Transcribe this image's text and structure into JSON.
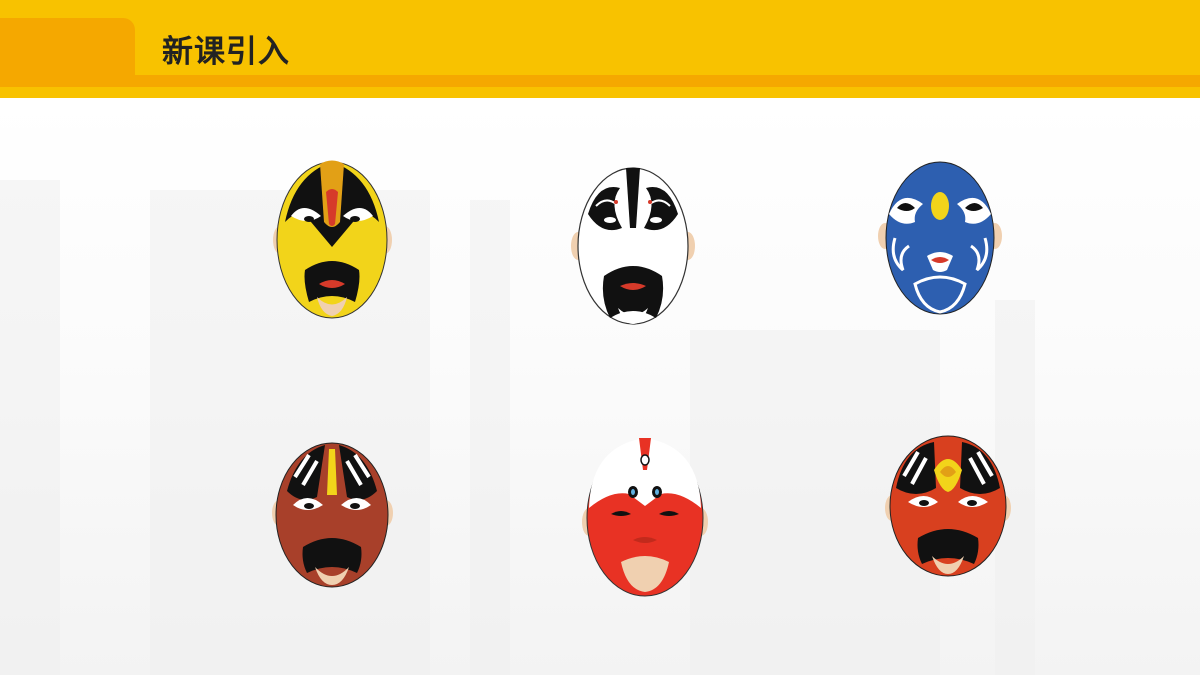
{
  "header": {
    "title": "新课引入"
  },
  "masks": [
    {
      "id": "mask-yellow",
      "base": "#f2d41a",
      "pattern": "#111111",
      "accent": "#d63a2a"
    },
    {
      "id": "mask-white",
      "base": "#ffffff",
      "pattern": "#111111",
      "accent": "#d63a2a"
    },
    {
      "id": "mask-blue",
      "base": "#2d5fb0",
      "pattern": "#ffffff",
      "accent": "#f2d41a"
    },
    {
      "id": "mask-maroon",
      "base": "#a8402a",
      "pattern": "#111111",
      "accent": "#f2d41a"
    },
    {
      "id": "mask-red-white",
      "base": "#e83224",
      "pattern": "#ffffff",
      "accent": "#d63a2a"
    },
    {
      "id": "mask-orange-red",
      "base": "#d8401f",
      "pattern": "#111111",
      "accent": "#f2d41a"
    }
  ]
}
